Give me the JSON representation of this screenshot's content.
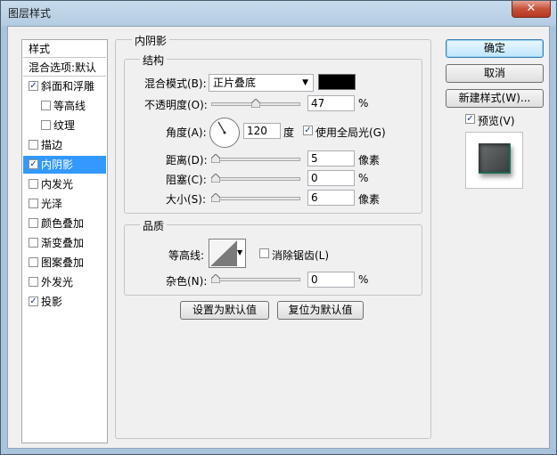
{
  "window": {
    "title": "图层样式",
    "close_glyph": "✕"
  },
  "styles_list": {
    "header": "样式",
    "blend_options": "混合选项:默认",
    "items": [
      {
        "label": "斜面和浮雕",
        "checked": true
      },
      {
        "label": "等高线",
        "checked": false,
        "indent": true
      },
      {
        "label": "纹理",
        "checked": false,
        "indent": true
      },
      {
        "label": "描边",
        "checked": false
      },
      {
        "label": "内阴影",
        "checked": true,
        "selected": true
      },
      {
        "label": "内发光",
        "checked": false
      },
      {
        "label": "光泽",
        "checked": false
      },
      {
        "label": "颜色叠加",
        "checked": false
      },
      {
        "label": "渐变叠加",
        "checked": false
      },
      {
        "label": "图案叠加",
        "checked": false
      },
      {
        "label": "外发光",
        "checked": false
      },
      {
        "label": "投影",
        "checked": true
      }
    ]
  },
  "panel": {
    "title": "内阴影",
    "structure": {
      "title": "结构",
      "blend_mode_label": "混合模式(B):",
      "blend_mode_value": "正片叠底",
      "blend_color": "#000000",
      "opacity_label": "不透明度(O):",
      "opacity_value": "47",
      "opacity_fraction": 0.47,
      "opacity_unit": "%",
      "angle_label": "角度(A):",
      "angle_value": "120",
      "angle_unit": "度",
      "global_light_label": "使用全局光(G)",
      "global_light_checked": true,
      "distance_label": "距离(D):",
      "distance_value": "5",
      "distance_unit": "像素",
      "choke_label": "阻塞(C):",
      "choke_value": "0",
      "choke_unit": "%",
      "size_label": "大小(S):",
      "size_value": "6",
      "size_unit": "像素"
    },
    "quality": {
      "title": "品质",
      "contour_label": "等高线:",
      "anti_alias_label": "消除锯齿(L)",
      "anti_alias_checked": false,
      "noise_label": "杂色(N):",
      "noise_value": "0",
      "noise_unit": "%"
    },
    "set_default_button": "设置为默认值",
    "reset_default_button": "复位为默认值"
  },
  "actions": {
    "ok": "确定",
    "cancel": "取消",
    "new_style": "新建样式(W)...",
    "preview_label": "预览(V)",
    "preview_checked": true
  },
  "colors": {
    "selection": "#3399ff",
    "check": "#1f3d7a"
  }
}
